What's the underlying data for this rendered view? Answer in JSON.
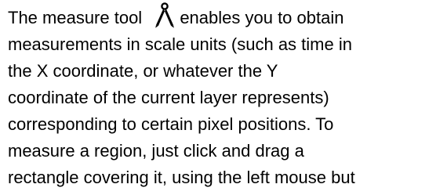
{
  "paragraph": {
    "lines": [
      {
        "before_icon": "The measure tool ",
        "after_icon": "enables you to obtain"
      },
      "measurements in scale units (such as time in",
      "the X coordinate, or whatever the Y",
      "coordinate of the current layer represents)",
      "corresponding to certain pixel positions. To",
      "measure a region, just click and drag a",
      "rectangle covering it, using the left mouse but"
    ],
    "icon": "measure-tool-compass-icon"
  }
}
